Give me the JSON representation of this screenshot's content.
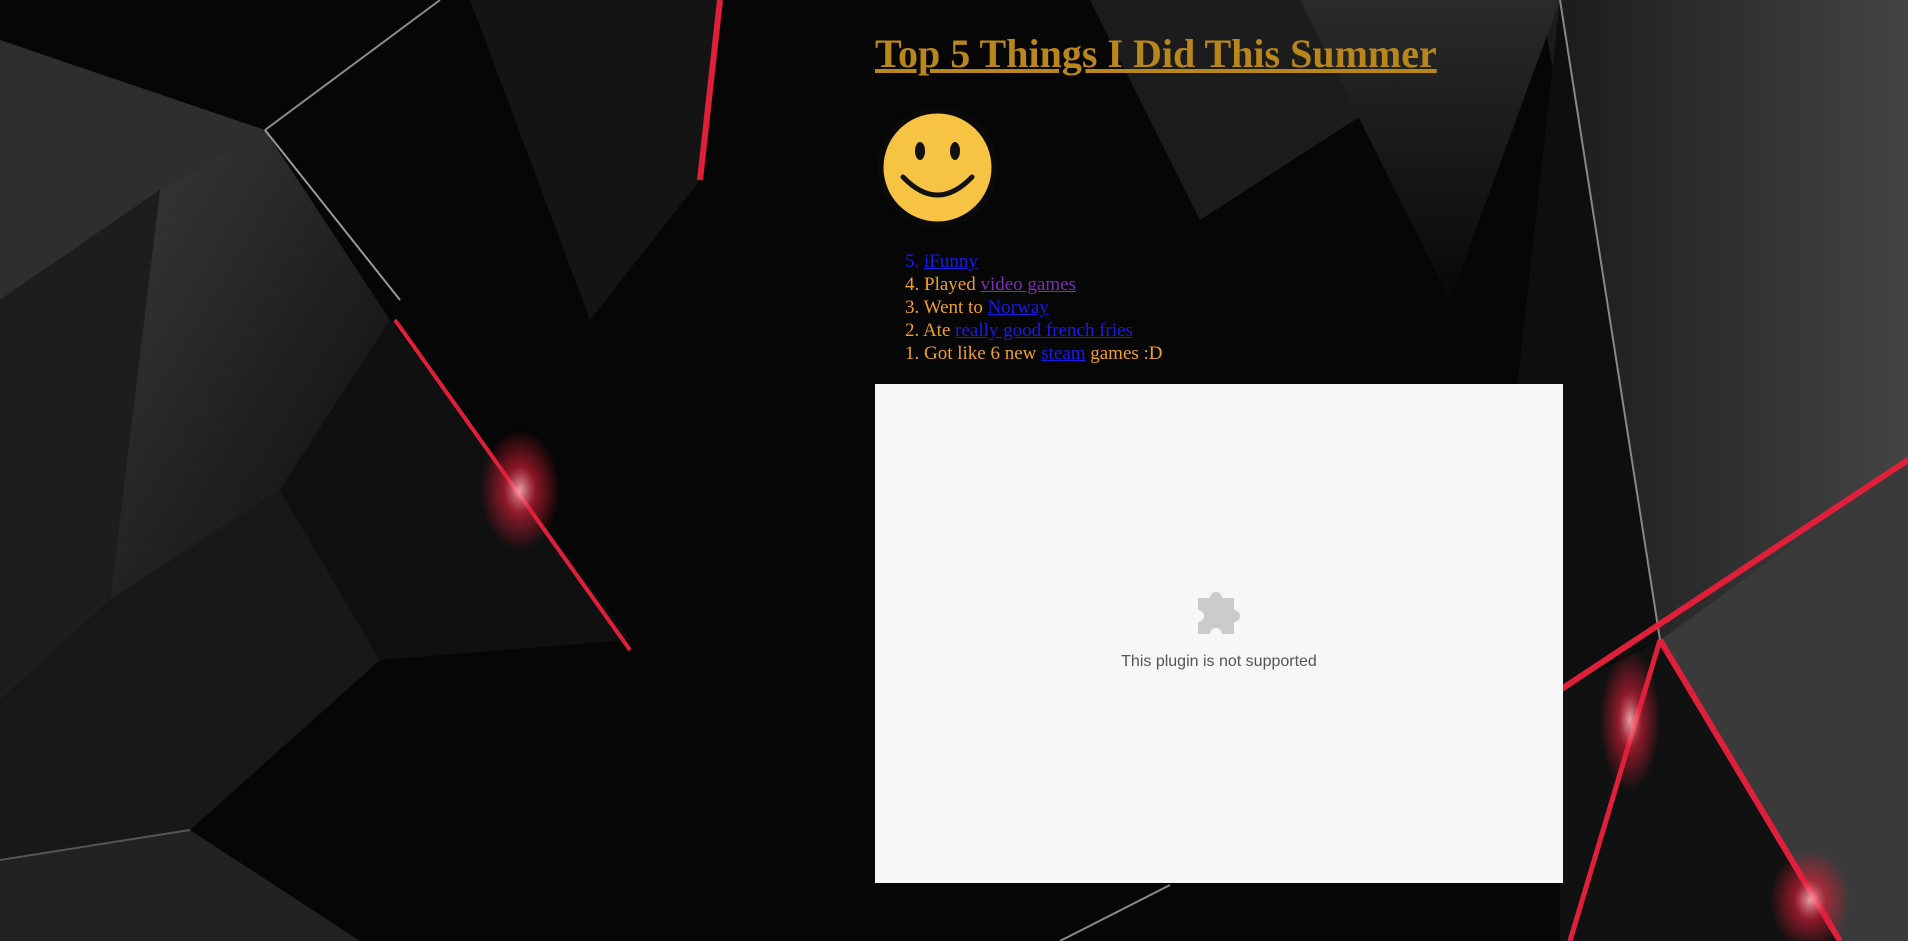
{
  "page": {
    "title": "Top 5 Things I Did This Summer"
  },
  "image": {
    "icon": "smiley-face"
  },
  "list": {
    "items": [
      {
        "number": "5.",
        "prefix": "",
        "link": "iFunny",
        "suffix": "",
        "number_color": "#1b1be6"
      },
      {
        "number": "4.",
        "prefix": "Played ",
        "link": "video games",
        "suffix": "",
        "number_color": "#f0a028"
      },
      {
        "number": "3.",
        "prefix": "Went to ",
        "link": "Norway",
        "suffix": "",
        "number_color": "#f0a028"
      },
      {
        "number": "2.",
        "prefix": "Ate ",
        "link": "really good french fries",
        "suffix": "",
        "number_color": "#f0a028"
      },
      {
        "number": "1.",
        "prefix": "Got like 6 new ",
        "link": "steam",
        "suffix": " games :D",
        "number_color": "#f0a028"
      }
    ]
  },
  "plugin": {
    "icon": "puzzle-piece-icon",
    "message": "This plugin is not supported"
  },
  "colors": {
    "title": "#b8861b",
    "list_text": "#f0a028",
    "link": "#1b1be6",
    "visited_link": "#7b2fb3",
    "plugin_bg": "#f7f7f7",
    "accent_red": "#e0203a"
  }
}
